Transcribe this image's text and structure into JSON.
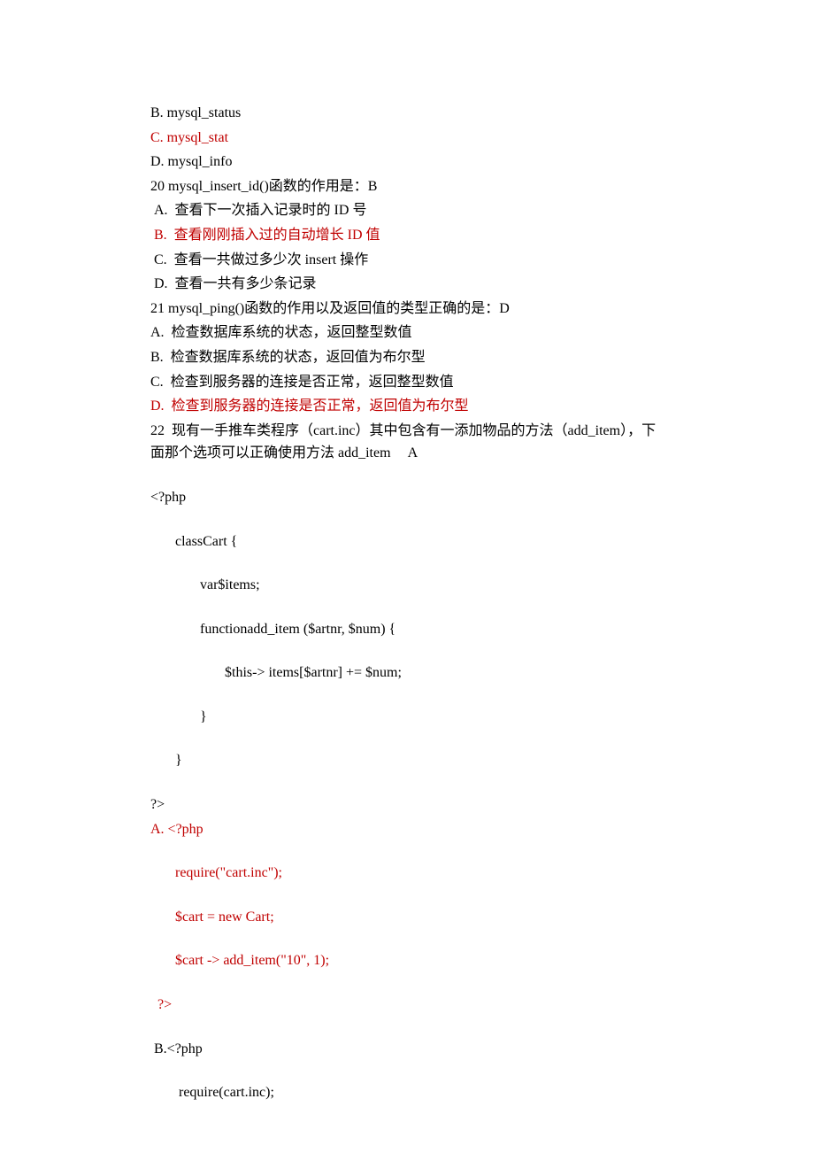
{
  "lines": [
    {
      "text": "B. mysql_status",
      "cls": ""
    },
    {
      "text": "C. mysql_stat",
      "cls": "red"
    },
    {
      "text": "D. mysql_info",
      "cls": ""
    },
    {
      "text": "20 mysql_insert_id()函数的作用是：B",
      "cls": ""
    },
    {
      "text": " A.  查看下一次插入记录时的 ID 号",
      "cls": ""
    },
    {
      "text": " B.  查看刚刚插入过的自动增长 ID 值",
      "cls": "red"
    },
    {
      "text": " C.  查看一共做过多少次 insert 操作",
      "cls": ""
    },
    {
      "text": " D.  查看一共有多少条记录",
      "cls": ""
    },
    {
      "text": "21 mysql_ping()函数的作用以及返回值的类型正确的是：D",
      "cls": ""
    },
    {
      "text": "A.  检查数据库系统的状态，返回整型数值",
      "cls": ""
    },
    {
      "text": "B.  检查数据库系统的状态，返回值为布尔型",
      "cls": ""
    },
    {
      "text": "C.  检查到服务器的连接是否正常，返回整型数值",
      "cls": ""
    },
    {
      "text": "D.  检查到服务器的连接是否正常，返回值为布尔型",
      "cls": "red"
    },
    {
      "text": "22  现有一手推车类程序（cart.inc）其中包含有一添加物品的方法（add_item），下面那个选项可以正确使用方法 add_item     A",
      "cls": ""
    },
    {
      "gap": true
    },
    {
      "text": "<?php",
      "cls": ""
    },
    {
      "gap": true
    },
    {
      "text": "classCart {",
      "cls": "indent1"
    },
    {
      "gap": true
    },
    {
      "text": "var$items;",
      "cls": "indent2"
    },
    {
      "gap": true
    },
    {
      "text": "functionadd_item ($artnr, $num) {",
      "cls": "indent2"
    },
    {
      "gap": true
    },
    {
      "text": "$this-> items[$artnr] += $num;",
      "cls": "indent3"
    },
    {
      "gap": true
    },
    {
      "text": "}",
      "cls": "indent2"
    },
    {
      "gap": true
    },
    {
      "text": "}",
      "cls": "indent1"
    },
    {
      "gap": true
    },
    {
      "text": "?>",
      "cls": ""
    },
    {
      "text": "A. <?php",
      "cls": "red"
    },
    {
      "gap": true
    },
    {
      "text": "require(\"cart.inc\");",
      "cls": "red indent1"
    },
    {
      "gap": true
    },
    {
      "text": "$cart = new Cart;",
      "cls": "red indent1"
    },
    {
      "gap": true
    },
    {
      "text": "$cart -> add_item(\"10\", 1);",
      "cls": "red indent1"
    },
    {
      "gap": true
    },
    {
      "text": "  ?>",
      "cls": "red"
    },
    {
      "gap": true
    },
    {
      "text": " B.<?php",
      "cls": ""
    },
    {
      "gap": true
    },
    {
      "text": " require(cart.inc);",
      "cls": "indent1"
    }
  ]
}
